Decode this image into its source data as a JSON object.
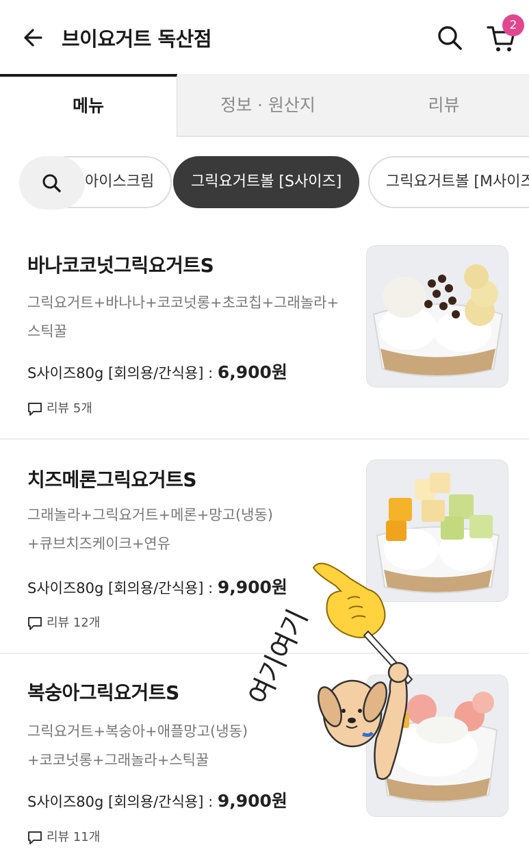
{
  "header": {
    "title": "브이요거트 독산점",
    "cart_count": "2",
    "icons": [
      "arrow-left-icon",
      "search-icon",
      "cart-icon"
    ]
  },
  "tabs": [
    {
      "label": "메뉴",
      "active": true
    },
    {
      "label": "정보 · 원산지",
      "active": false
    },
    {
      "label": "리뷰",
      "active": false
    }
  ],
  "categories": [
    {
      "label": "아이스크림",
      "active": false
    },
    {
      "label": "그릭요거트볼 [S사이즈]",
      "active": true
    },
    {
      "label": "그릭요거트볼 [M사이즈]",
      "active": false
    }
  ],
  "items": [
    {
      "name": "바나코코넛그릭요거트S",
      "desc_line1": "그릭요거트+바나나+코코넛롱+초코칩+그래놀라+",
      "desc_line2": "스틱꿀",
      "price_label": "S사이즈80g [회의용/간식용] : ",
      "price": "6,900원",
      "review": "리뷰 5개"
    },
    {
      "name": "치즈메론그릭요거트S",
      "desc_line1": "그래놀라+그릭요거트+메론+망고(냉동)",
      "desc_line2": "+큐브치즈케이크+연유",
      "price_label": "S사이즈80g [회의용/간식용] : ",
      "price": "9,900원",
      "review": "리뷰 12개"
    },
    {
      "name": "복숭아그릭요거트S",
      "desc_line1": "그릭요거트+복숭아+애플망고(냉동)",
      "desc_line2": "+코코넛롱+그래놀라+스틱꿀",
      "price_label": "S사이즈80g [회의용/간식용] : ",
      "price": "9,900원",
      "review": "리뷰 11개"
    }
  ],
  "sticker_text": "여기여기",
  "colors": {
    "accent_badge": "#e0478f",
    "active_chip": "#3a3a3a"
  }
}
